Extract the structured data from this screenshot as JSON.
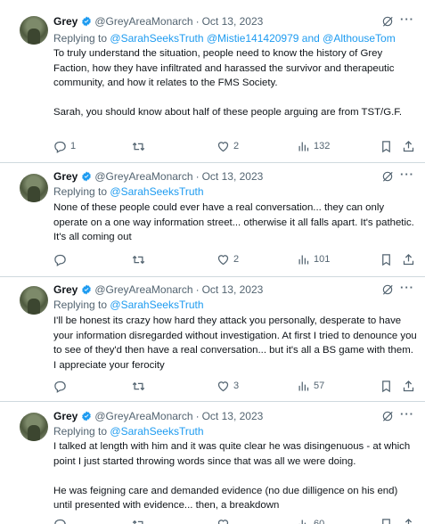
{
  "tweets": [
    {
      "author_name": "Grey",
      "author_handle": "@GreyAreaMonarch",
      "date": "Oct 13, 2023",
      "replying_label": "Replying to",
      "mentions": [
        "@SarahSeeksTruth",
        "@Mistie141420979",
        "and",
        "@AlthouseTom"
      ],
      "text": "To truly understand the situation, people need to know the history of Grey Faction, how they have infiltrated and harassed the survivor and therapeutic community, and how it relates to the FMS Society.\n\nSarah, you should know about half of these people arguing are from TST/G.F.",
      "replies": "1",
      "retweets": "",
      "likes": "2",
      "views": "132"
    },
    {
      "author_name": "Grey",
      "author_handle": "@GreyAreaMonarch",
      "date": "Oct 13, 2023",
      "replying_label": "Replying to",
      "mentions": [
        "@SarahSeeksTruth"
      ],
      "text": "None of these people could ever have a real conversation... they can only operate on a one way information street... otherwise it all falls apart. It's pathetic.  It's all coming out",
      "replies": "",
      "retweets": "",
      "likes": "2",
      "views": "101"
    },
    {
      "author_name": "Grey",
      "author_handle": "@GreyAreaMonarch",
      "date": "Oct 13, 2023",
      "replying_label": "Replying to",
      "mentions": [
        "@SarahSeeksTruth"
      ],
      "text": "I'll be honest its crazy how hard they attack you personally, desperate to have your information disregarded without investigation. At first I tried to denounce you to see of they'd then have a real conversation... but it's all a BS game with them. I appreciate your ferocity",
      "replies": "",
      "retweets": "",
      "likes": "3",
      "views": "57"
    },
    {
      "author_name": "Grey",
      "author_handle": "@GreyAreaMonarch",
      "date": "Oct 13, 2023",
      "replying_label": "Replying to",
      "mentions": [
        "@SarahSeeksTruth"
      ],
      "text": "I talked at length with him and it was quite clear he was disingenuous - at which point I just started throwing words since that was all we were doing.\n\nHe was feigning care and demanded evidence (no due dilligence on his end) until presented with evidence... then, a breakdown",
      "replies": "",
      "retweets": "",
      "likes": "",
      "views": "60"
    }
  ],
  "colors": {
    "accent": "#1d9bf0",
    "muted": "#536471",
    "text": "#0f1419",
    "divider": "#cfd9de"
  },
  "icons": [
    "verified-badge-icon",
    "grok-icon",
    "more-icon",
    "reply-icon",
    "retweet-icon",
    "like-icon",
    "views-icon",
    "bookmark-icon",
    "share-icon"
  ]
}
